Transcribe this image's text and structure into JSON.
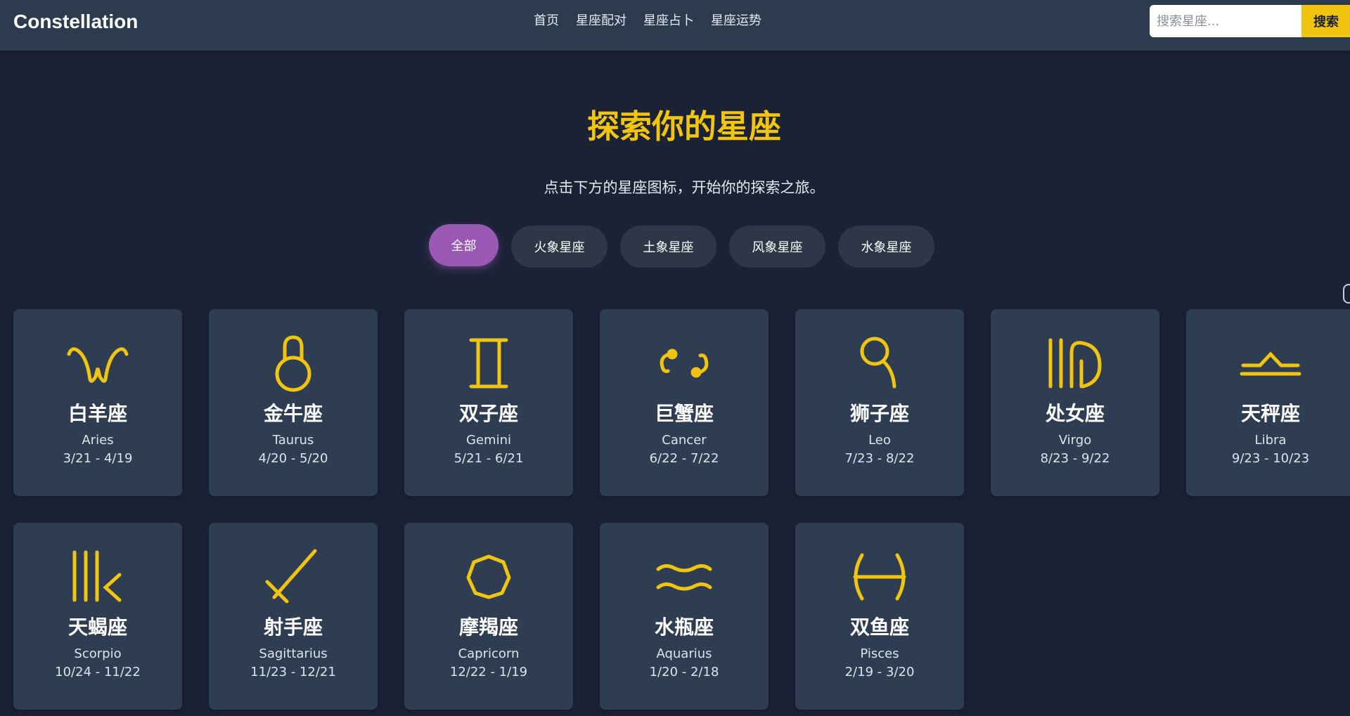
{
  "header": {
    "brand": "Constellation",
    "nav": [
      "首页",
      "星座配对",
      "星座占卜",
      "星座运势"
    ],
    "search_placeholder": "搜索星座...",
    "search_button": "搜索"
  },
  "hero": {
    "title": "探索你的星座",
    "subtitle": "点击下方的星座图标，开始你的探索之旅。"
  },
  "filters": [
    "全部",
    "火象星座",
    "土象星座",
    "风象星座",
    "水象星座"
  ],
  "active_filter": "全部",
  "colors": {
    "accent": "#f1c40f",
    "active_chip": "#9b59b6",
    "card_bg": "#2f3d52",
    "page_bg": "#1b2236"
  },
  "signs": [
    {
      "cn": "白羊座",
      "en": "Aries",
      "dates": "3/21 - 4/19",
      "icon": "aries-icon"
    },
    {
      "cn": "金牛座",
      "en": "Taurus",
      "dates": "4/20 - 5/20",
      "icon": "taurus-icon"
    },
    {
      "cn": "双子座",
      "en": "Gemini",
      "dates": "5/21 - 6/21",
      "icon": "gemini-icon"
    },
    {
      "cn": "巨蟹座",
      "en": "Cancer",
      "dates": "6/22 - 7/22",
      "icon": "cancer-icon"
    },
    {
      "cn": "狮子座",
      "en": "Leo",
      "dates": "7/23 - 8/22",
      "icon": "leo-icon"
    },
    {
      "cn": "处女座",
      "en": "Virgo",
      "dates": "8/23 - 9/22",
      "icon": "virgo-icon"
    },
    {
      "cn": "天秤座",
      "en": "Libra",
      "dates": "9/23 - 10/23",
      "icon": "libra-icon"
    },
    {
      "cn": "天蝎座",
      "en": "Scorpio",
      "dates": "10/24 - 11/22",
      "icon": "scorpio-icon"
    },
    {
      "cn": "射手座",
      "en": "Sagittarius",
      "dates": "11/23 - 12/21",
      "icon": "sagittarius-icon"
    },
    {
      "cn": "摩羯座",
      "en": "Capricorn",
      "dates": "12/22 - 1/19",
      "icon": "capricorn-icon"
    },
    {
      "cn": "水瓶座",
      "en": "Aquarius",
      "dates": "1/20 - 2/18",
      "icon": "aquarius-icon"
    },
    {
      "cn": "双鱼座",
      "en": "Pisces",
      "dates": "2/19 - 3/20",
      "icon": "pisces-icon"
    }
  ]
}
